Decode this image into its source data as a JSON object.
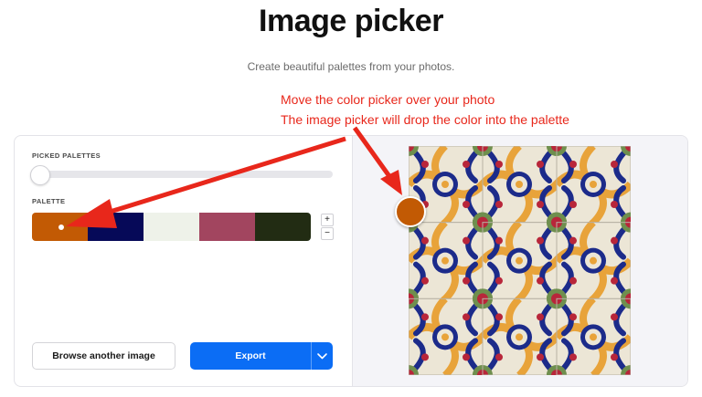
{
  "header": {
    "title": "Image picker",
    "subtitle": "Create beautiful palettes from your photos."
  },
  "annotation": {
    "line1": "Move the color picker over your photo",
    "line2": "The image picker will drop the color into the palette",
    "color": "#e8271b"
  },
  "sidebar": {
    "picked_palettes_label": "PICKED PALETTES",
    "picked_palettes_slider_value": 0,
    "palette_label": "PALETTE",
    "palette": [
      {
        "color": "#c25a04",
        "selected": true
      },
      {
        "color": "#060958",
        "selected": false
      },
      {
        "color": "#eef2e9",
        "selected": false
      },
      {
        "color": "#a2455f",
        "selected": false
      },
      {
        "color": "#222c13",
        "selected": false
      }
    ],
    "plus_label": "+",
    "minus_label": "−",
    "browse_label": "Browse another image",
    "export_label": "Export",
    "export_color": "#0b6df5"
  },
  "photo": {
    "picker_color": "#c25a04",
    "tile_colors": {
      "background": "#ece6d6",
      "orange": "#e8a33a",
      "blue": "#1c2b8a",
      "red": "#b8263a",
      "green": "#6f8f4e",
      "grout": "#b7b1a4"
    }
  }
}
